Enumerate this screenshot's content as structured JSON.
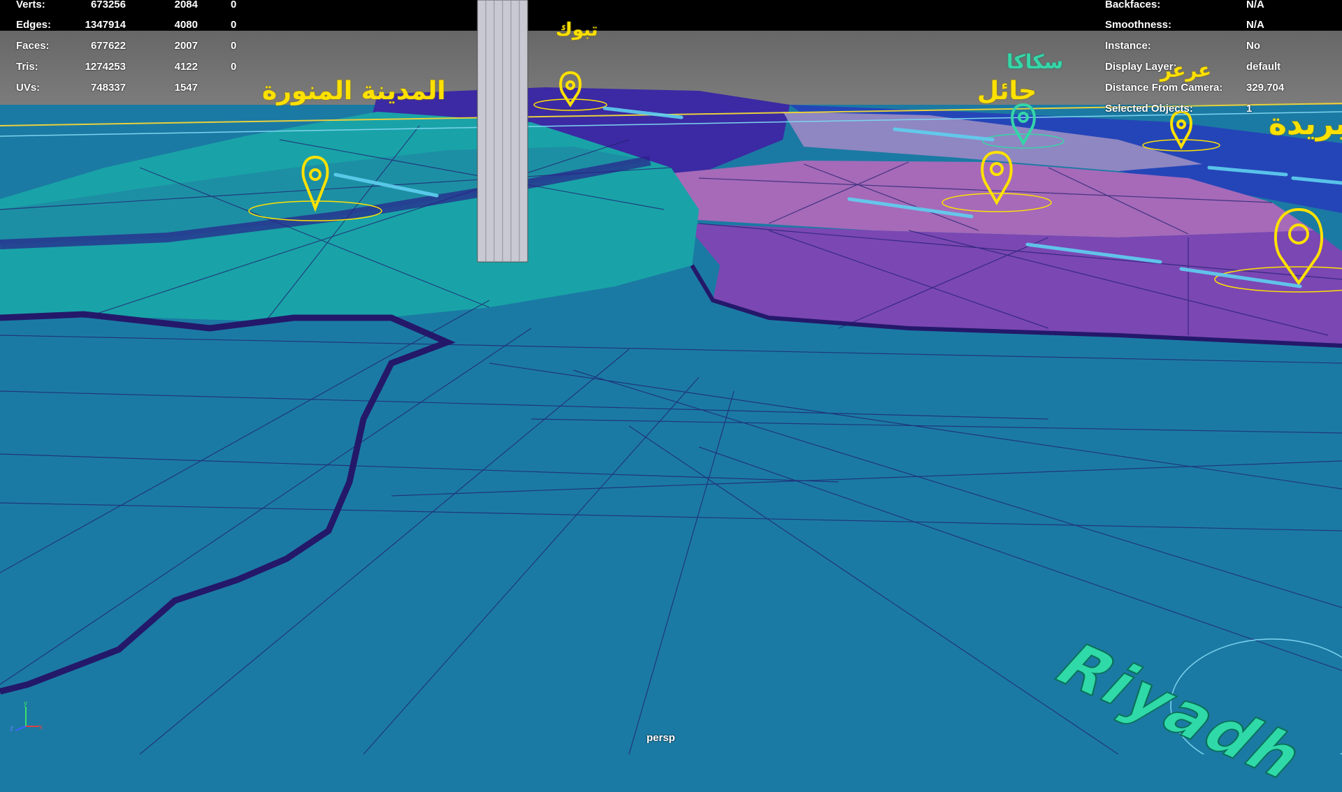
{
  "hud_left": {
    "rows": [
      {
        "label": "Verts:",
        "v1": "673256",
        "v2": "2084",
        "v3": "0"
      },
      {
        "label": "Edges:",
        "v1": "1347914",
        "v2": "4080",
        "v3": "0"
      },
      {
        "label": "Faces:",
        "v1": "677622",
        "v2": "2007",
        "v3": "0"
      },
      {
        "label": "Tris:",
        "v1": "1274253",
        "v2": "4122",
        "v3": "0"
      },
      {
        "label": "UVs:",
        "v1": "748337",
        "v2": "1547",
        "v3": ""
      }
    ]
  },
  "hud_right": {
    "rows": [
      {
        "label": "Backfaces:",
        "value": "N/A"
      },
      {
        "label": "Smoothness:",
        "value": "N/A"
      },
      {
        "label": "Instance:",
        "value": "No"
      },
      {
        "label": "Display Layer:",
        "value": "default"
      },
      {
        "label": "Distance From Camera:",
        "value": "329.704"
      },
      {
        "label": "Selected Objects:",
        "value": "1"
      }
    ]
  },
  "camera_label": "persp",
  "axis": {
    "x": "x",
    "y": "y",
    "z": "z"
  },
  "city_labels": {
    "madinah": "المدينة المنورة",
    "tabuk": "تبوك",
    "hail": "حائل",
    "sakaka": "سكاكا",
    "arar": "عرعر",
    "buraydah": "بريدة",
    "riyadh": "Riyadh"
  },
  "colors": {
    "sea": "#1b7aa3",
    "teal_region": "#19a3a8",
    "purple_region": "#7b47b3",
    "lilac_region": "#a66ab8",
    "navy_region": "#3b2aa3",
    "blue_region": "#2445b8",
    "pin": "#ffe100",
    "pin_teal": "#35d6a8"
  }
}
